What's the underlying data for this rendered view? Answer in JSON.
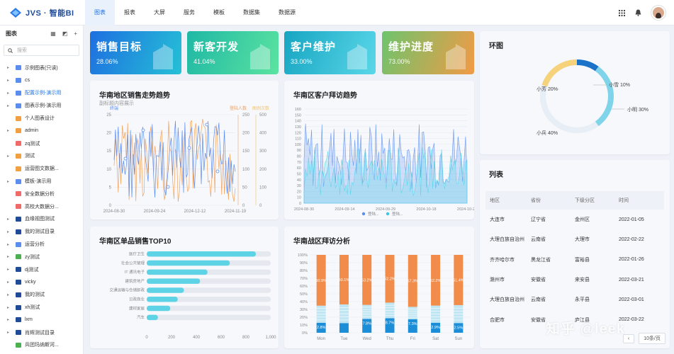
{
  "app": {
    "logo_text": "JVS · 智能BI"
  },
  "nav": {
    "items": [
      "图表",
      "报表",
      "大屏",
      "服务",
      "模板",
      "数据集",
      "数据源"
    ],
    "active": 0
  },
  "sidebar": {
    "title": "图表",
    "search_placeholder": "搜索",
    "items": [
      {
        "label": "示例图表(只读)",
        "color": "#5b8def",
        "arrow": "▸"
      },
      {
        "label": "cs",
        "color": "#5b8def",
        "arrow": "▸"
      },
      {
        "label": "配置示例-演示用",
        "color": "#5b8def",
        "arrow": "▸",
        "highlight": true
      },
      {
        "label": "图表示例-演示用",
        "color": "#5b8def",
        "arrow": "▸"
      },
      {
        "label": "个人图表设计",
        "color": "#f0a040",
        "arrow": ""
      },
      {
        "label": "admin",
        "color": "#f0a040",
        "arrow": "▸"
      },
      {
        "label": "zq测试",
        "color": "#f06a6a",
        "arrow": ""
      },
      {
        "label": "测试",
        "color": "#f0a040",
        "arrow": "▸"
      },
      {
        "label": "运营图文数据...",
        "color": "#f0a040",
        "arrow": ""
      },
      {
        "label": "模板-演示用",
        "color": "#5b8def",
        "arrow": "▸"
      },
      {
        "label": "安全数据分析",
        "color": "#f06a6a",
        "arrow": ""
      },
      {
        "label": "高校大数据分...",
        "color": "#f06a6a",
        "arrow": ""
      },
      {
        "label": "血缘视图测试",
        "color": "#1f4b99",
        "arrow": "▸"
      },
      {
        "label": "我的测试目录",
        "color": "#1f4b99",
        "arrow": "▸"
      },
      {
        "label": "运营分析",
        "color": "#5b8def",
        "arrow": "▸"
      },
      {
        "label": "zy测试",
        "color": "#4caf50",
        "arrow": "▸"
      },
      {
        "label": "dj测试",
        "color": "#1f4b99",
        "arrow": "▸"
      },
      {
        "label": "vicky",
        "color": "#1f4b99",
        "arrow": "▸"
      },
      {
        "label": "我的测试",
        "color": "#1f4b99",
        "arrow": "▸"
      },
      {
        "label": "xh测试",
        "color": "#1f4b99",
        "arrow": "▸"
      },
      {
        "label": "lxm",
        "color": "#1f4b99",
        "arrow": "▸"
      },
      {
        "label": "肖辉测试目录",
        "color": "#1f4b99",
        "arrow": "▸"
      },
      {
        "label": "兵团玛纳斯河...",
        "color": "#4caf50",
        "arrow": ""
      }
    ]
  },
  "kpis": [
    {
      "title": "销售目标",
      "value": "28.06%"
    },
    {
      "title": "新客开发",
      "value": "41.04%"
    },
    {
      "title": "客户维护",
      "value": "33.00%"
    },
    {
      "title": "维护进度",
      "value": "73.00%"
    }
  ],
  "panels": {
    "sales_trend": {
      "title": "华南地区销售走势趋势",
      "subtitle": "副标题内容展示"
    },
    "visit_trend": {
      "title": "华南区客户拜访趋势"
    },
    "top10": {
      "title": "华南区单品销售TOP10"
    },
    "visit_analysis": {
      "title": "华南战区拜访分析"
    },
    "ring": {
      "title": "环图"
    },
    "list": {
      "title": "列表"
    }
  },
  "chart_data": [
    {
      "type": "line",
      "title": "华南地区销售走势趋势",
      "subtitle": "副标题内容展示",
      "x_ticks": [
        "2024-08-30",
        "2024-09-24",
        "2024-12-12",
        "2024-11-19"
      ],
      "series": [
        {
          "name": "终端",
          "axis": "left"
        },
        {
          "name": "登陆人数",
          "axis": "right1"
        },
        {
          "name": "图例次数",
          "axis": "right2"
        }
      ],
      "y_left": [
        0,
        5,
        10,
        15,
        20,
        25
      ],
      "y_right1": [
        0,
        50,
        100,
        150,
        200,
        250
      ],
      "y_right2": [
        0,
        100,
        200,
        300,
        400,
        500
      ]
    },
    {
      "type": "area",
      "title": "华南区客户拜访趋势",
      "x_ticks": [
        "2024-08-30",
        "2024-09-14",
        "2024-09-29",
        "2024-10-18",
        "2024-10-29"
      ],
      "y_ticks": [
        0,
        10,
        20,
        30,
        40,
        50,
        60,
        70,
        80,
        90,
        100,
        110,
        120,
        130,
        140,
        150,
        160
      ],
      "legend": [
        "登陆...",
        "登陆..."
      ]
    },
    {
      "type": "bar",
      "title": "华南区单品销售TOP10",
      "categories": [
        "医疗卫生",
        "社会公共管理",
        "IT 通讯电子",
        "建筑房地产",
        "交通运输与仓储邮政",
        "日政商业",
        "建材家居",
        "汽车"
      ],
      "values": [
        880,
        670,
        490,
        430,
        300,
        250,
        190,
        90
      ],
      "x_ticks": [
        0,
        200,
        400,
        600,
        800,
        "1,000"
      ],
      "xlim": [
        0,
        1000
      ]
    },
    {
      "type": "bar",
      "stacked": true,
      "title": "华南战区拜访分析",
      "categories": [
        "Mon",
        "Tue",
        "Wed",
        "Thu",
        "Fri",
        "Sat",
        "Sun"
      ],
      "y_ticks": [
        "0%",
        "10%",
        "20%",
        "30%",
        "40%",
        "50%",
        "60%",
        "70%",
        "80%",
        "90%",
        "100%"
      ],
      "top_labels": [
        "50.9%",
        "50.1%",
        "53.2%",
        "52.2%",
        "57.3%",
        "52.2%",
        "51.4%"
      ],
      "bottom_labels": [
        "2.8%",
        "",
        "7.8%",
        "8.7%",
        "7.3%",
        "2.9%",
        "2.5%"
      ],
      "top_values": [
        50.9,
        50.1,
        53.2,
        52.2,
        57.3,
        52.2,
        51.4
      ],
      "mid_values": [
        22,
        24,
        18,
        20,
        16,
        22,
        23
      ],
      "bottom_values": [
        12.8,
        12.4,
        17.8,
        18.7,
        17.3,
        12.9,
        12.5
      ]
    },
    {
      "type": "pie",
      "title": "环图",
      "slices": [
        {
          "label": "小雪",
          "value": 10,
          "display": "小雪 10%",
          "color": "#1a73c8"
        },
        {
          "label": "小明",
          "value": 30,
          "display": "小明 30%",
          "color": "#7fd4ea"
        },
        {
          "label": "小兵",
          "value": 40,
          "display": "小兵 40%",
          "color": "#e8eef6"
        },
        {
          "label": "小芳",
          "value": 20,
          "display": "小芳 20%",
          "color": "#f6d27a"
        }
      ]
    }
  ],
  "table": {
    "headers": [
      "地区",
      "省份",
      "下级分区",
      "时间"
    ],
    "rows": [
      [
        "大连市",
        "辽宁省",
        "金州区",
        "2022-01-05"
      ],
      [
        "大理白族自治州",
        "云南省",
        "大理市",
        "2022-02-22"
      ],
      [
        "齐齐哈尔市",
        "黑龙江省",
        "富裕县",
        "2022-01-26"
      ],
      [
        "滁州市",
        "安徽省",
        "来安县",
        "2022-03-21"
      ],
      [
        "大理白族自治州",
        "云南省",
        "永平县",
        "2022-03-01"
      ],
      [
        "合肥市",
        "安徽省",
        "庐江县",
        "2022-03-22"
      ]
    ],
    "pager": "10条/页"
  },
  "watermark": "知乎 @leek"
}
